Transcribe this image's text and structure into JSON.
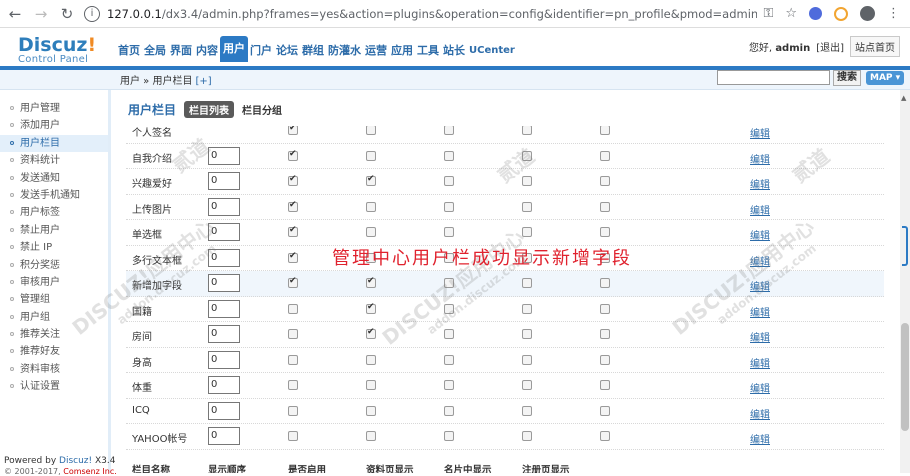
{
  "browser": {
    "url_host": "127.0.0.1",
    "url_path": "/dx3.4/admin.php?frames=yes&action=plugins&operation=config&identifier=pn_profile&pmod=admin_members&op=add"
  },
  "header": {
    "logo_brand": "Discuz",
    "logo_excl": "!",
    "logo_sub": "Control Panel",
    "nav": [
      "首页",
      "全局",
      "界面",
      "内容",
      "用户",
      "门户",
      "论坛",
      "群组",
      "防灌水",
      "运营",
      "应用",
      "工具",
      "站长",
      "UCenter"
    ],
    "active_nav": "用户",
    "greeting": "您好,",
    "username": "admin",
    "logout": "[退出]",
    "site_home": "站点首页"
  },
  "crumbbar": {
    "path": "用户 » 用户栏目",
    "plus": "[+]",
    "search_label": "搜索",
    "map_label": "MAP ▾"
  },
  "sidebar": {
    "items": [
      "用户管理",
      "添加用户",
      "用户栏目",
      "资料统计",
      "发送通知",
      "发送手机通知",
      "用户标签",
      "禁止用户",
      "禁止 IP",
      "积分奖惩",
      "审核用户",
      "管理组",
      "用户组",
      "推荐关注",
      "推荐好友",
      "资料审核",
      "认证设置"
    ],
    "active": "用户栏目",
    "powered_prefix": "Powered by ",
    "powered_brand": "Discuz!",
    "powered_version": " X3.4",
    "copyright_prefix": "© 2001-2017, ",
    "copyright_company": "Comsenz Inc."
  },
  "main": {
    "title": "用户栏目",
    "tab_active": "栏目列表",
    "tab_other": "栏目分组",
    "edit_label": "编辑",
    "rows": [
      {
        "name": "个人签名",
        "order": "",
        "checks": [
          true,
          false,
          false,
          false,
          false
        ],
        "partial": true
      },
      {
        "name": "自我介绍",
        "order": "0",
        "checks": [
          true,
          false,
          false,
          false,
          false
        ]
      },
      {
        "name": "兴趣爱好",
        "order": "0",
        "checks": [
          true,
          true,
          false,
          false,
          false
        ]
      },
      {
        "name": "上传图片",
        "order": "0",
        "checks": [
          true,
          false,
          false,
          false,
          false
        ]
      },
      {
        "name": "单选框",
        "order": "0",
        "checks": [
          true,
          false,
          false,
          false,
          false
        ]
      },
      {
        "name": "多行文本框",
        "order": "0",
        "checks": [
          true,
          false,
          false,
          false,
          false
        ]
      },
      {
        "name": "新增加字段",
        "order": "0",
        "checks": [
          true,
          true,
          false,
          false,
          false
        ],
        "highlight": true
      },
      {
        "name": "国籍",
        "order": "0",
        "checks": [
          false,
          true,
          false,
          false,
          false
        ]
      },
      {
        "name": "房间",
        "order": "0",
        "checks": [
          false,
          true,
          false,
          false,
          false
        ]
      },
      {
        "name": "身高",
        "order": "0",
        "checks": [
          false,
          false,
          false,
          false,
          false
        ]
      },
      {
        "name": "体重",
        "order": "0",
        "checks": [
          false,
          false,
          false,
          false,
          false
        ]
      },
      {
        "name": "ICQ",
        "order": "0",
        "checks": [
          false,
          false,
          false,
          false,
          false
        ]
      },
      {
        "name": "YAHOO帐号",
        "order": "0",
        "checks": [
          false,
          false,
          false,
          false,
          false
        ]
      }
    ],
    "footer_headers": [
      "栏目名称",
      "显示顺序",
      "是否启用",
      "资料页显示",
      "名片中显示",
      "注册页显示"
    ]
  },
  "annotation": "管理中心用户栏成功显示新增字段",
  "watermark": {
    "line1": "DISCUZ!应用中心",
    "line2": "addon.discuz.com",
    "mark": "贰道"
  }
}
